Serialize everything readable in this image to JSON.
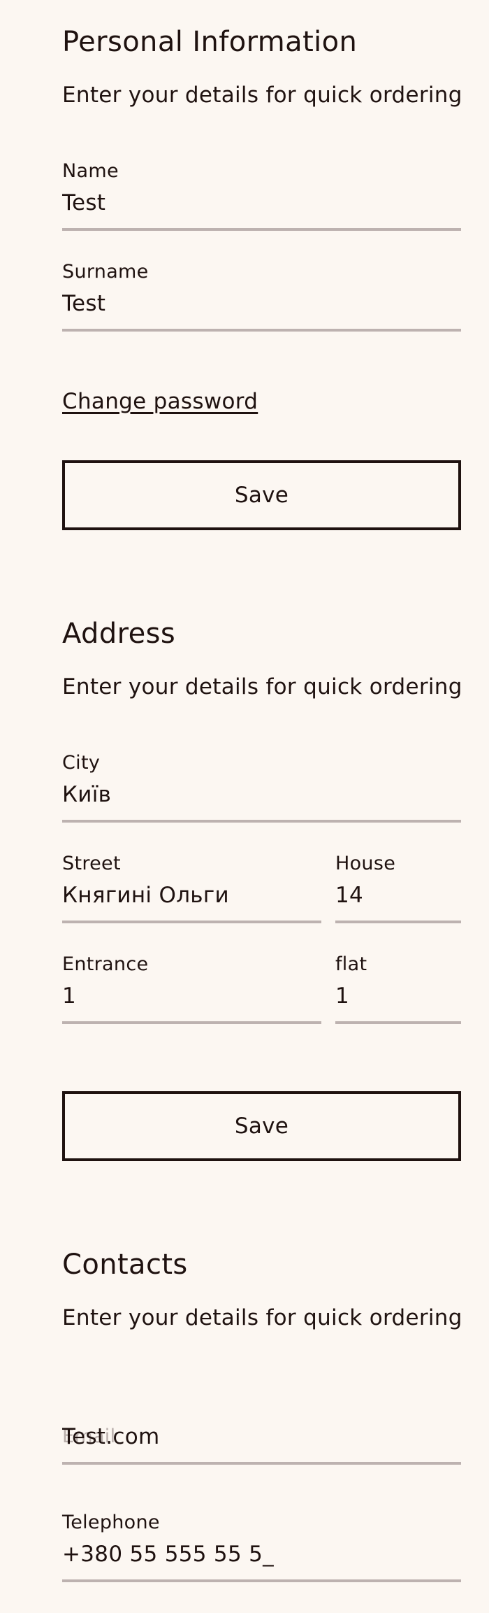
{
  "personal": {
    "title": "Personal Information",
    "subtitle": "Enter your details for quick ordering",
    "name_label": "Name",
    "name_value": "Test",
    "surname_label": "Surname",
    "surname_value": "Test",
    "change_password": "Change password",
    "save_label": "Save"
  },
  "address": {
    "title": "Address",
    "subtitle": "Enter your details for quick ordering",
    "city_label": "City",
    "city_value": "Київ",
    "street_label": "Street",
    "street_value": "Княгині Ольги",
    "house_label": "House",
    "house_value": "14",
    "entrance_label": "Entrance",
    "entrance_value": "1",
    "flat_label": "flat",
    "flat_value": "1",
    "save_label": "Save"
  },
  "contacts": {
    "title": "Contacts",
    "subtitle": "Enter your details for quick ordering",
    "email_label": "Email",
    "email_value": "Test.com",
    "telephone_label": "Telephone",
    "telephone_value": "+380 55 555 55 5_"
  },
  "colors": {
    "background": "#fcf7f2",
    "text": "#1f1210",
    "underline": "#bdb2b0",
    "placeholder": "#b9afac"
  }
}
